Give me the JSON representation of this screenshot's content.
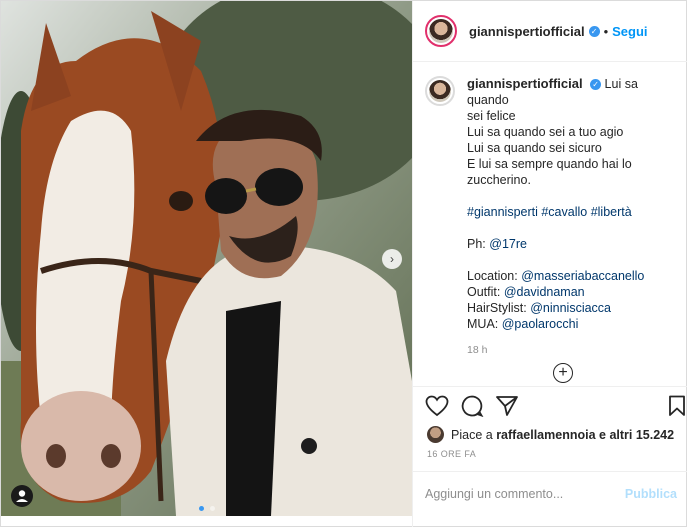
{
  "post": {
    "handle": "giannispertiofficial",
    "follow_label": "Segui",
    "separator": "•",
    "verified_mark": "✓",
    "caption_lines": [
      "Lui sa quando",
      "sei felice",
      "Lui sa quando sei a tuo agio",
      "Lui sa quando sei sicuro",
      "E lui sa sempre quando hai lo",
      "zuccherino."
    ],
    "hashtags": "#giannisperti #cavallo #libertà",
    "photo_credit_label": "Ph:",
    "photo_credit_user": "@17re",
    "credits": [
      {
        "label": "Location:",
        "user": "@masseriabaccanello"
      },
      {
        "label": "Outfit:",
        "user": "@davidnaman"
      },
      {
        "label": "HairStylist:",
        "user": "@ninnisciacca"
      },
      {
        "label": "MUA:",
        "user": "@paolarocchi"
      }
    ],
    "caption_time": "18 h",
    "load_more_icon": "plus-circle-icon",
    "likes_prefix": "Piace a",
    "likes_user": "raffaellamennoia",
    "likes_suffix": "e altri 15.242",
    "posted_ago": "16 ORE FA",
    "comment_placeholder": "Aggiungi un commento...",
    "publish_label": "Pubblica"
  },
  "media": {
    "icons": {
      "next": "chevron-right-icon",
      "tag": "user-tag-icon"
    },
    "carousel_pages": 2,
    "carousel_active": 1
  },
  "colors": {
    "accent": "#0095f6",
    "link": "#00376b",
    "muted": "#8e8e8e"
  }
}
